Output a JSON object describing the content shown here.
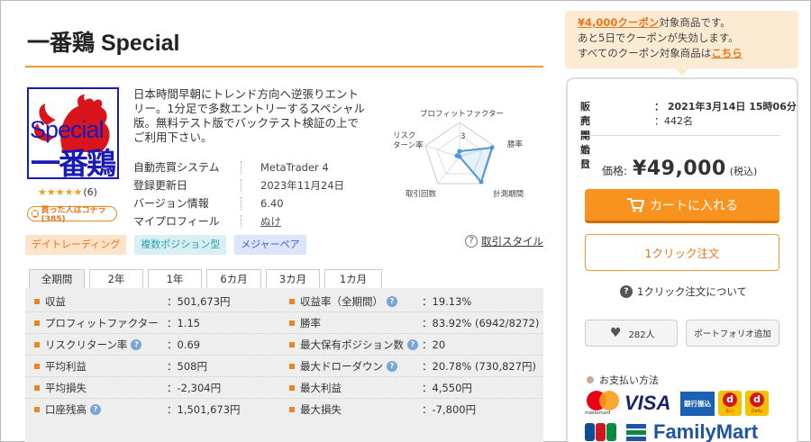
{
  "product": {
    "title": "一番鶏 Special",
    "logo_text_1": "Special",
    "logo_text_2": "一番鶏",
    "rating_stars": "★★★★★",
    "rating_value": 5,
    "review_count": "(6)",
    "buyer_button": "買った人はコチラ(385)",
    "description": "日本時間早朝にトレンド方向へ逆張りエントリー。1分足で多数エントリーするスペシャル版。無料テスト版でバックテスト検証の上でご利用下さい。"
  },
  "info": [
    {
      "label": "自動売買システム",
      "value": "MetaTrader 4"
    },
    {
      "label": "登録更新日",
      "value": "2023年11月24日"
    },
    {
      "label": "バージョン情報",
      "value": "6.40"
    },
    {
      "label": "マイプロフィール",
      "value": "ぬけ"
    }
  ],
  "radar": {
    "labels": {
      "profit_factor": "プロフィットファクター",
      "win_rate": "勝率",
      "period": "計測期間",
      "trades": "取引回数",
      "risk_return": "リスク\nターン率"
    },
    "scale_label": "3"
  },
  "tags": [
    "デイトレーディング",
    "複数ポジション型",
    "メジャーペア"
  ],
  "trading_style_link": "取引スタイル",
  "period_tabs": [
    "全期間",
    "2年",
    "1年",
    "6カ月",
    "3カ月",
    "1カ月"
  ],
  "stats_left": [
    {
      "label": "収益",
      "value": "：501,673円",
      "help": false
    },
    {
      "label": "プロフィットファクター",
      "value": "：1.15",
      "help": false
    },
    {
      "label": "リスクリターン率",
      "value": "：0.69",
      "help": true
    },
    {
      "label": "平均利益",
      "value": "：508円",
      "help": false
    },
    {
      "label": "平均損失",
      "value": "：-2,304円",
      "help": false
    },
    {
      "label": "口座残高",
      "value": "：1,501,673円",
      "help": true
    }
  ],
  "stats_right": [
    {
      "label": "収益率（全期間）",
      "value": "：19.13%",
      "help": true
    },
    {
      "label": "勝率",
      "value": "：83.92% (6942/8272)",
      "help": false
    },
    {
      "label": "最大保有ポジション数",
      "value": "：20",
      "help": true
    },
    {
      "label": "最大ドローダウン",
      "value": "：20.78% (730,827円)",
      "help": true
    },
    {
      "label": "最大利益",
      "value": "：4,550円",
      "help": false
    },
    {
      "label": "最大損失",
      "value": "：-7,800円",
      "help": false
    }
  ],
  "coupon": {
    "highlight": "¥4,000クーポン",
    "line1_rest": "対象商品です。",
    "line2": "あと5日でクーポンが失効します。",
    "line3_prefix": "すべてのクーポン対象商品は",
    "line3_link": "こちら"
  },
  "sales": {
    "start_label": "販売開始日",
    "start_value": "：  2021年3月14日 15時06分",
    "users_label": "利用者数",
    "users_value": "：442名",
    "price_label": "価格:",
    "price": "¥49,000",
    "tax": "(税込)",
    "cart_button": "カートに入れる",
    "oneclick_button": "1クリック注文",
    "oneclick_about": "1クリック注文について",
    "favorite_count": "282人",
    "portfolio_button": "ポートフォリオ追加",
    "payment_title": "お支払い方法"
  },
  "payment_logos": {
    "mastercard": "mastercard",
    "visa": "VISA",
    "bank": "銀行振込",
    "dpay": "d",
    "dpay_caption": "払い",
    "dpay2_caption": "Daily",
    "jcb": "JCB",
    "familymart": "FamilyMart"
  },
  "colors": {
    "accent": "#f7931e",
    "title_rule": "#f29933",
    "logo_blue": "#1a1ab8",
    "stats_bg": "#eeeeee"
  }
}
